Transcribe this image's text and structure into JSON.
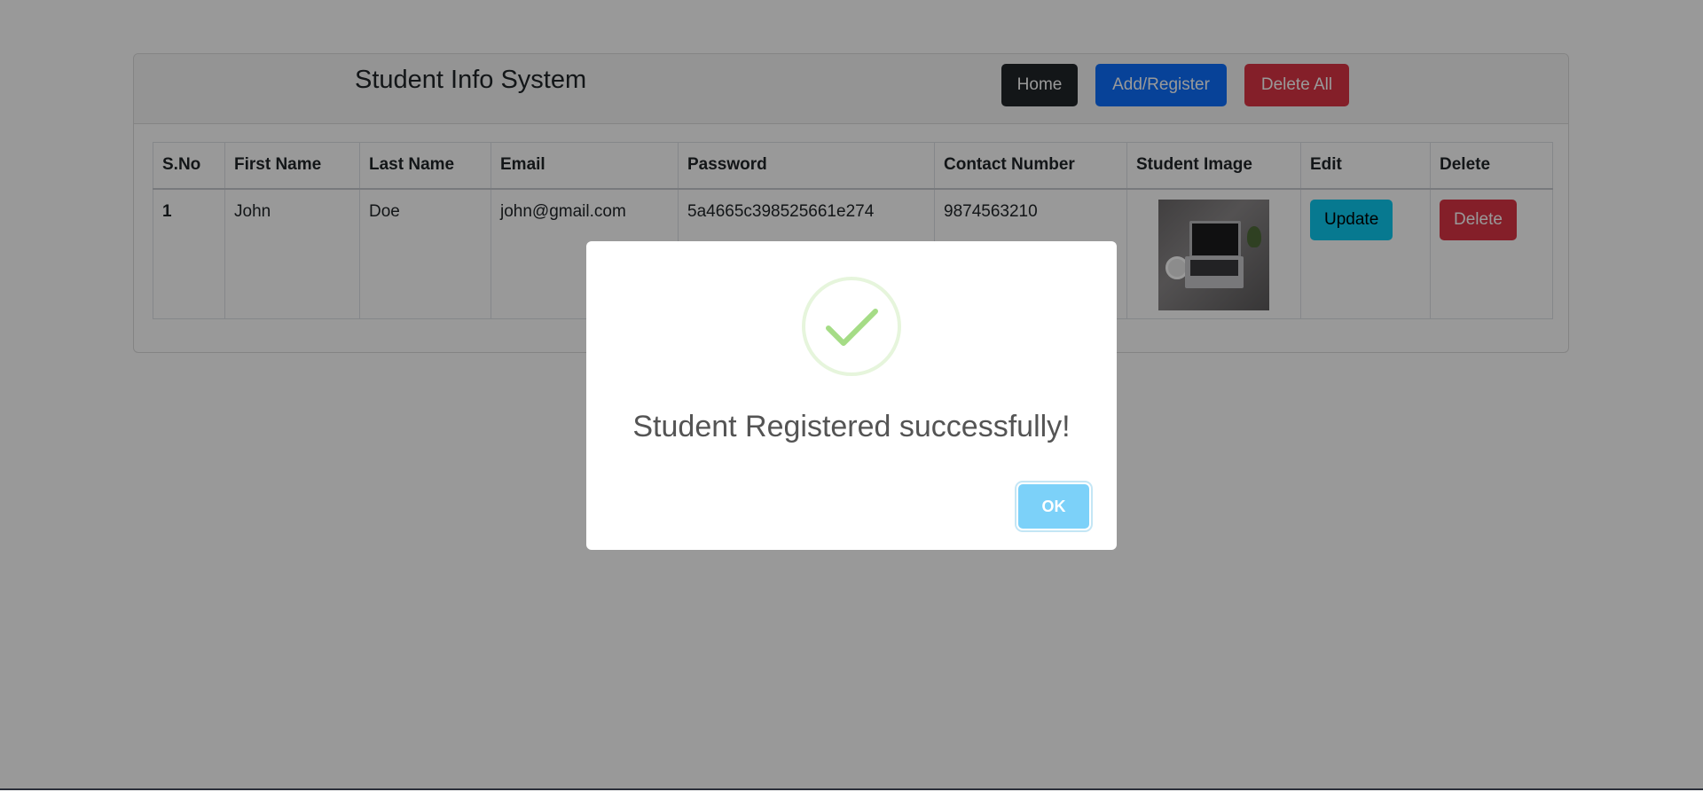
{
  "header": {
    "title": "Student Info System",
    "buttons": {
      "home": "Home",
      "add_register": "Add/Register",
      "delete_all": "Delete All"
    }
  },
  "table": {
    "columns": [
      "S.No",
      "First Name",
      "Last Name",
      "Email",
      "Password",
      "Contact Number",
      "Student Image",
      "Edit",
      "Delete"
    ],
    "rows": [
      {
        "sno": "1",
        "first_name": "John",
        "last_name": "Doe",
        "email": "john@gmail.com",
        "password": "5a4665c398525661e274",
        "contact": "9874563210",
        "image": "laptop-on-desk-photo",
        "edit_label": "Update",
        "delete_label": "Delete"
      }
    ]
  },
  "dialog": {
    "icon": "success-check-icon",
    "message": "Student Registered successfully!",
    "ok_label": "OK"
  },
  "colors": {
    "home_button": "#212529",
    "add_button": "#0d6efd",
    "delete_button": "#dc3545",
    "update_button": "#0dcaf0",
    "ok_button": "#7cd1f9",
    "success_check": "#a5dc86",
    "overlay": "rgba(0,0,0,0.4)"
  }
}
